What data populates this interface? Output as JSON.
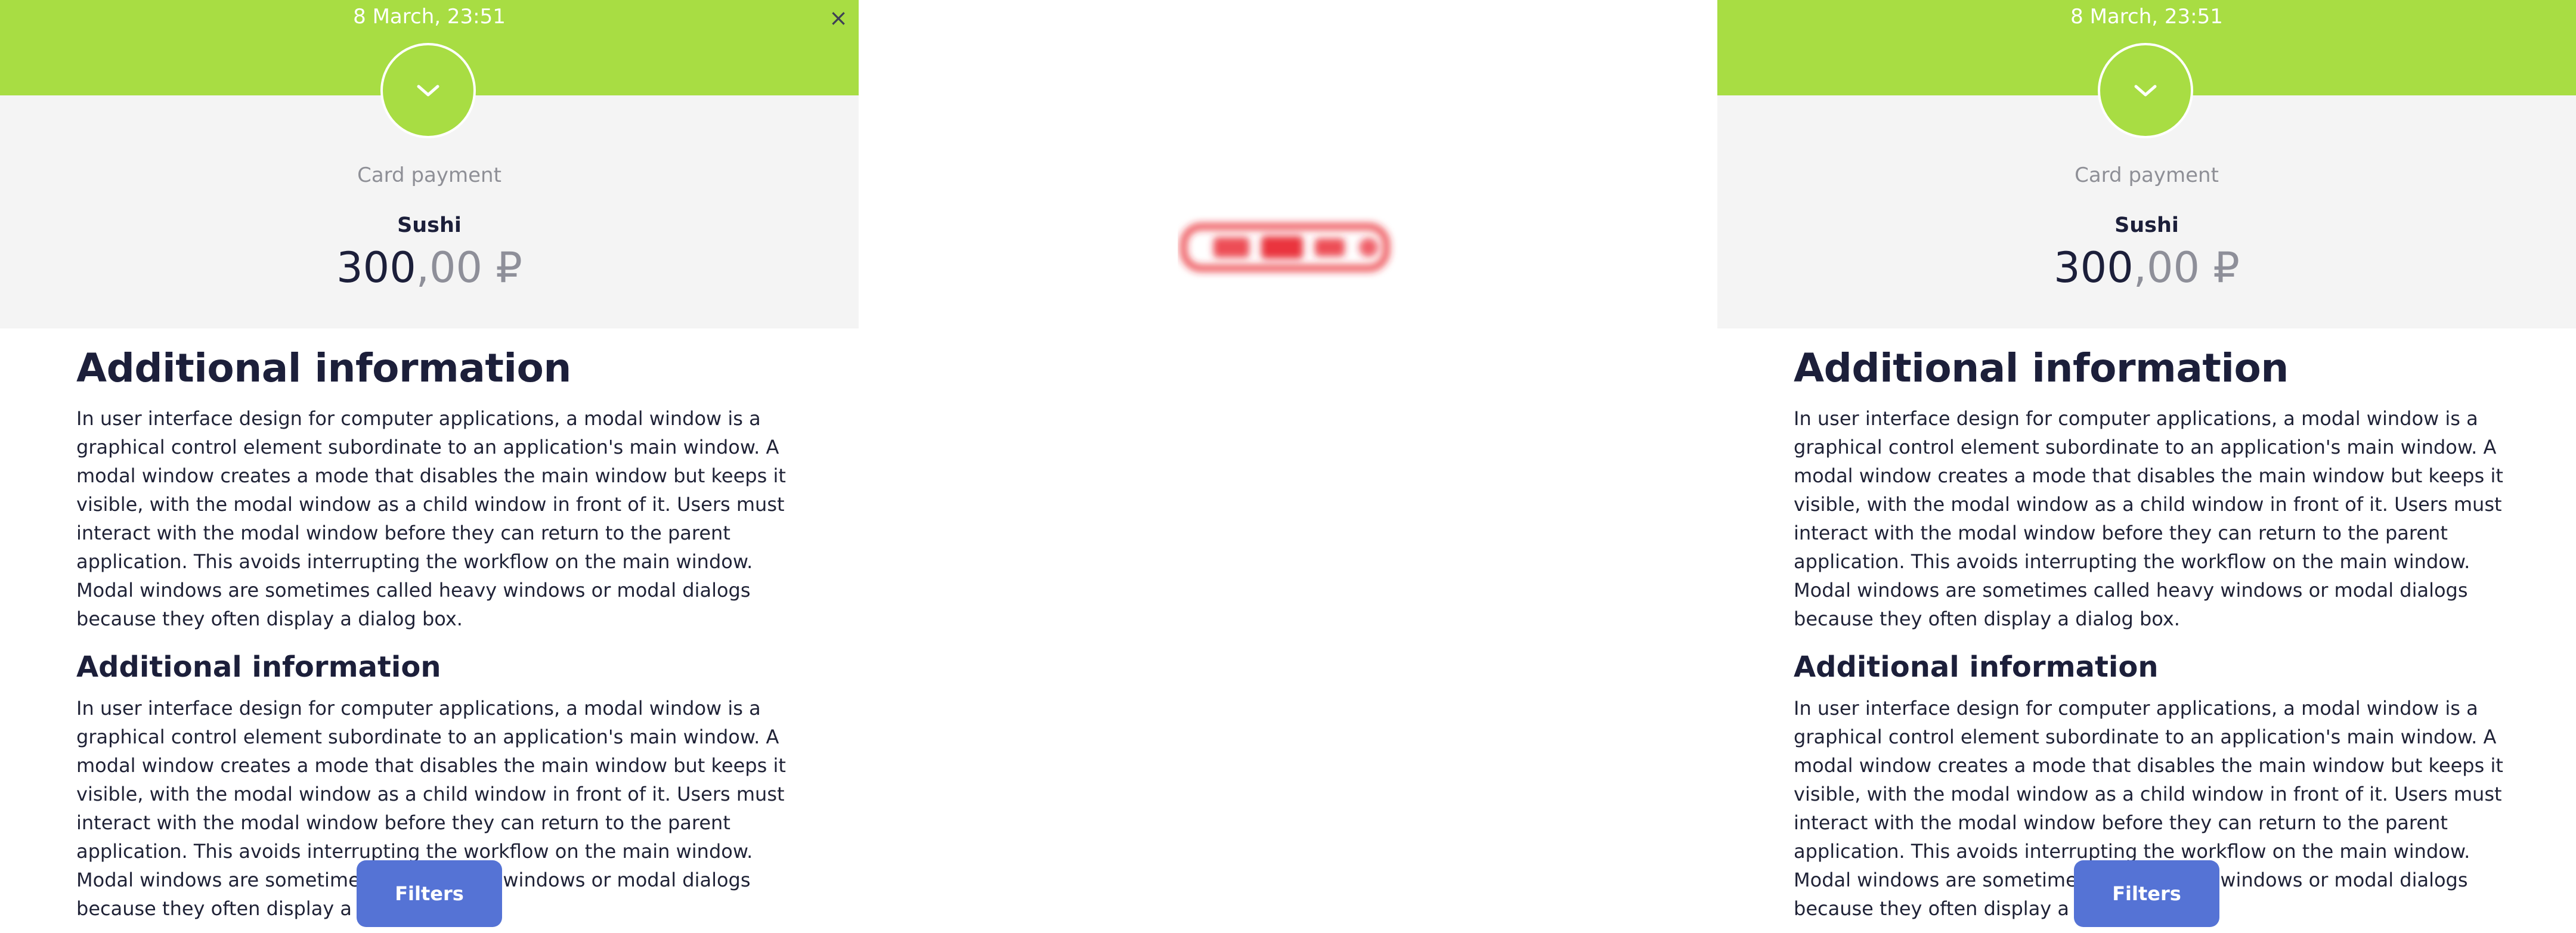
{
  "screens": [
    {
      "datetime": "8 March, 23:51",
      "close_label": "×",
      "status_icon": "chevron-down-icon",
      "payment_method": "Card payment",
      "merchant": "Sushi",
      "amount": {
        "integer": "300",
        "decimal": ",00",
        "currency": "₽"
      },
      "sections": [
        {
          "title": "Additional information",
          "text": "In user interface design for computer applications, a modal window is a graphical control element subordinate to an application's main window. A modal window creates a mode that disables the main window but keeps it visible, with the modal window as a child window in front of it. Users must interact with the modal window before they can return to the parent application. This avoids interrupting the workflow on the main window. Modal windows are sometimes called heavy windows or modal dialogs because they often display a dialog box."
        },
        {
          "title": "Additional information",
          "text": "In user interface design for computer applications, a modal window is a graphical control element subordinate to an application's main window. A modal window creates a mode that disables the main window but keeps it visible, with the modal window as a child window in front of it. Users must interact with the modal window before they can return to the parent application. This avoids interrupting the workflow on the main window. Modal windows are sometimes called heavy windows or modal dialogs because they often display a dialog box."
        }
      ],
      "filters_label": "Filters"
    },
    {
      "datetime": "8 March, 23:51",
      "close_label": "×",
      "status_icon": "chevron-down-icon",
      "payment_method": "Card payment",
      "merchant": "Sushi",
      "amount": {
        "integer": "300",
        "decimal": ",00",
        "currency": "₽"
      },
      "sections": [
        {
          "title": "Additional information",
          "text": "In user interface design for computer applications, a modal window is a graphical control element subordinate to an application's main window. A modal window creates a mode that disables the main window but keeps it visible, with the modal window as a child window in front of it. Users must interact with the modal window before they can return to the parent application. This avoids interrupting the workflow on the main window. Modal windows are sometimes called heavy windows or modal dialogs because they often display a dialog box."
        },
        {
          "title": "Additional information",
          "text": "In user interface design for computer applications, a modal window is a graphical control element subordinate to an application's main window. A modal window creates a mode that disables the main window but keeps it visible, with the modal window as a child window in front of it. Users must interact with the modal window before they can return to the parent application. This avoids interrupting the workflow on the main window. Modal windows are sometimes called heavy windows or modal dialogs because they often display a dialog box."
        }
      ],
      "filters_label": "Filters"
    }
  ],
  "stamp": {
    "icon": "blurred-red-stamp",
    "color": "#e8202a"
  },
  "colors": {
    "accent_green": "#a8dd43",
    "header_bg": "#f4f4f4",
    "button_blue": "#5573d5",
    "text_dark": "#1c1f3a",
    "text_muted": "#8e8f96"
  }
}
